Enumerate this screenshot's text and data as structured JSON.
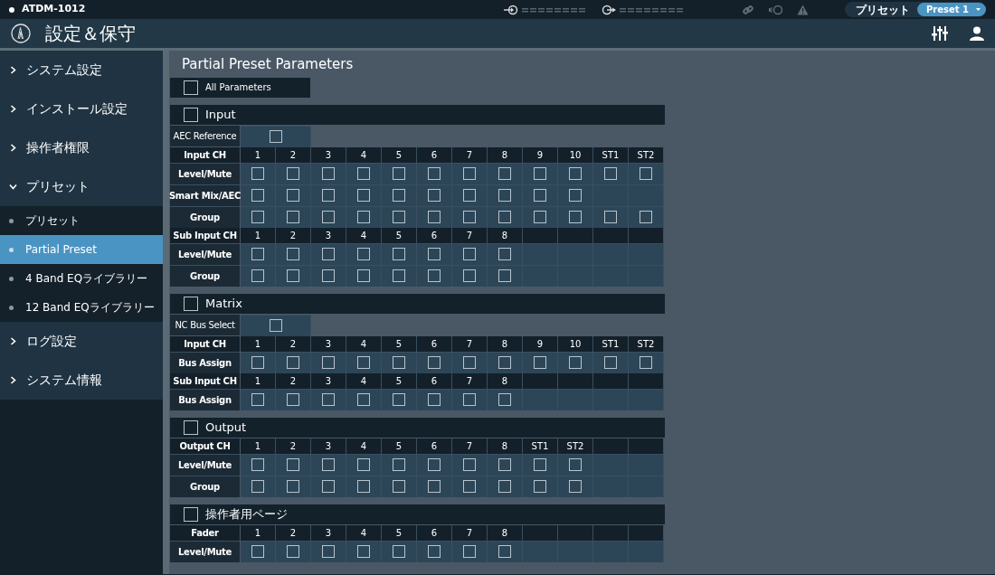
{
  "top_bar": {
    "device": "ATDM-1012",
    "preset_label": "プリセット",
    "preset_value": "Preset 1"
  },
  "header": {
    "title": "設定＆保守"
  },
  "sidebar": {
    "items": [
      {
        "label": "システム設定",
        "expanded": false
      },
      {
        "label": "インストール設定",
        "expanded": false
      },
      {
        "label": "操作者権限",
        "expanded": false
      },
      {
        "label": "プリセット",
        "expanded": true,
        "children": [
          {
            "label": "プリセット",
            "selected": false
          },
          {
            "label": "Partial Preset",
            "selected": true
          },
          {
            "label": "4 Band EQライブラリー",
            "selected": false
          },
          {
            "label": "12 Band EQライブラリー",
            "selected": false
          }
        ]
      },
      {
        "label": "ログ設定",
        "expanded": false
      },
      {
        "label": "システム情報",
        "expanded": false
      }
    ]
  },
  "content": {
    "title": "Partial Preset Parameters",
    "all_parameters": {
      "label": "All Parameters",
      "checked": false
    },
    "sections": [
      {
        "title": "Input",
        "checked": false,
        "rows": [
          {
            "kind": "single",
            "label": "AEC Reference",
            "checked": false
          },
          {
            "kind": "header",
            "label": "Input CH",
            "cells": [
              "1",
              "2",
              "3",
              "4",
              "5",
              "6",
              "7",
              "8",
              "9",
              "10",
              "ST1",
              "ST2"
            ]
          },
          {
            "kind": "checks",
            "label": "Level/Mute",
            "checks": [
              false,
              false,
              false,
              false,
              false,
              false,
              false,
              false,
              false,
              false,
              false,
              false
            ]
          },
          {
            "kind": "checks",
            "label": "Smart Mix/AEC",
            "checks": [
              false,
              false,
              false,
              false,
              false,
              false,
              false,
              false,
              false,
              false
            ]
          },
          {
            "kind": "checks",
            "label": "Group",
            "checks": [
              false,
              false,
              false,
              false,
              false,
              false,
              false,
              false,
              false,
              false,
              false,
              false
            ]
          },
          {
            "kind": "header",
            "label": "Sub Input CH",
            "cells": [
              "1",
              "2",
              "3",
              "4",
              "5",
              "6",
              "7",
              "8"
            ]
          },
          {
            "kind": "checks",
            "label": "Level/Mute",
            "checks": [
              false,
              false,
              false,
              false,
              false,
              false,
              false,
              false
            ]
          },
          {
            "kind": "checks",
            "label": "Group",
            "checks": [
              false,
              false,
              false,
              false,
              false,
              false,
              false,
              false
            ]
          }
        ]
      },
      {
        "title": "Matrix",
        "checked": false,
        "rows": [
          {
            "kind": "single",
            "label": "NC Bus Select",
            "checked": false
          },
          {
            "kind": "header",
            "label": "Input CH",
            "cells": [
              "1",
              "2",
              "3",
              "4",
              "5",
              "6",
              "7",
              "8",
              "9",
              "10",
              "ST1",
              "ST2"
            ]
          },
          {
            "kind": "checks",
            "label": "Bus Assign",
            "checks": [
              false,
              false,
              false,
              false,
              false,
              false,
              false,
              false,
              false,
              false,
              false,
              false
            ]
          },
          {
            "kind": "header",
            "label": "Sub Input CH",
            "cells": [
              "1",
              "2",
              "3",
              "4",
              "5",
              "6",
              "7",
              "8"
            ]
          },
          {
            "kind": "checks",
            "label": "Bus Assign",
            "checks": [
              false,
              false,
              false,
              false,
              false,
              false,
              false,
              false
            ]
          }
        ]
      },
      {
        "title": "Output",
        "checked": false,
        "rows": [
          {
            "kind": "header",
            "label": "Output CH",
            "cells": [
              "1",
              "2",
              "3",
              "4",
              "5",
              "6",
              "7",
              "8",
              "ST1",
              "ST2"
            ]
          },
          {
            "kind": "checks",
            "label": "Level/Mute",
            "checks": [
              false,
              false,
              false,
              false,
              false,
              false,
              false,
              false,
              false,
              false
            ]
          },
          {
            "kind": "checks",
            "label": "Group",
            "checks": [
              false,
              false,
              false,
              false,
              false,
              false,
              false,
              false,
              false,
              false
            ]
          }
        ]
      },
      {
        "title": "操作者用ページ",
        "checked": false,
        "rows": [
          {
            "kind": "header",
            "label": "Fader",
            "cells": [
              "1",
              "2",
              "3",
              "4",
              "5",
              "6",
              "7",
              "8"
            ]
          },
          {
            "kind": "checks",
            "label": "Level/Mute",
            "checks": [
              false,
              false,
              false,
              false,
              false,
              false,
              false,
              false
            ]
          }
        ]
      }
    ]
  }
}
